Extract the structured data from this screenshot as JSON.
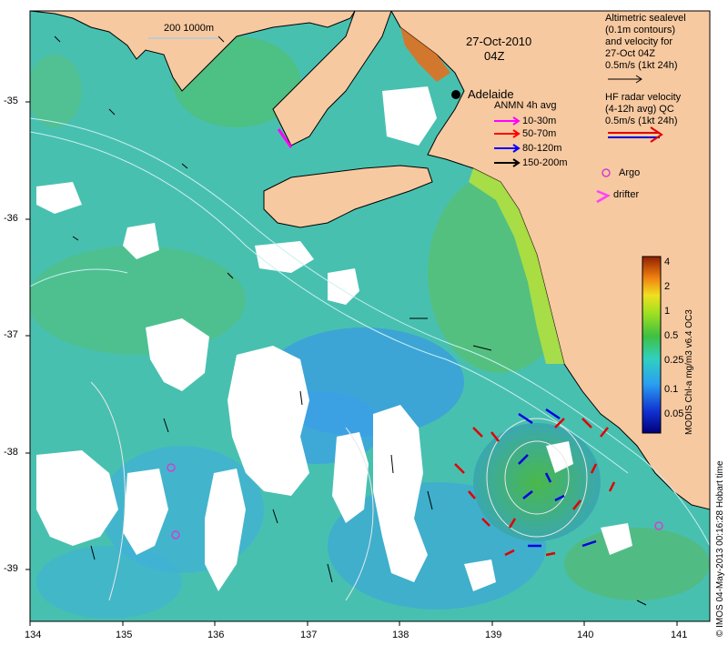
{
  "map": {
    "date": "27-Oct-2010",
    "time": "04Z",
    "scale_label": "200  1000m",
    "city": "Adelaide",
    "x_ticks": [
      "134",
      "135",
      "136",
      "137",
      "138",
      "139",
      "140",
      "141"
    ],
    "y_ticks": [
      "-35",
      "-36",
      "-37",
      "-38",
      "-39"
    ],
    "colors": {
      "land": "#f7c9a0",
      "ocean_low": "#3aa0e0",
      "ocean_mid": "#44c2a8",
      "ocean_high": "#44b848",
      "cloud": "#ffffff",
      "isobath": "#c8f0f0"
    }
  },
  "legend": {
    "altimetry_lines": [
      "Altimetric sealevel",
      "(0.1m contours)",
      "and velocity for",
      "27-Oct 04Z",
      "0.5m/s (1kt 24h)"
    ],
    "hf_lines": [
      "HF radar velocity",
      "(4-12h avg) QC",
      "0.5m/s (1kt 24h)"
    ],
    "anmn_title": "ANMN 4h avg",
    "anmn_items": [
      {
        "label": "10-30m",
        "color": "#ff00ff"
      },
      {
        "label": "50-70m",
        "color": "#ff0000"
      },
      {
        "label": "80-120m",
        "color": "#0000ff"
      },
      {
        "label": "150-200m",
        "color": "#000000"
      }
    ],
    "argo_label": "Argo",
    "drifter_label": "drifter"
  },
  "colorbar": {
    "title": "MODIS Chl-a mg/m3 v6.4 OC3",
    "ticks": [
      "4",
      "2",
      "1",
      "0.5",
      "0.25",
      "0.1",
      "0.05"
    ]
  },
  "credit": "© IMOS 04-May-2013 00:16:28 Hobart time"
}
